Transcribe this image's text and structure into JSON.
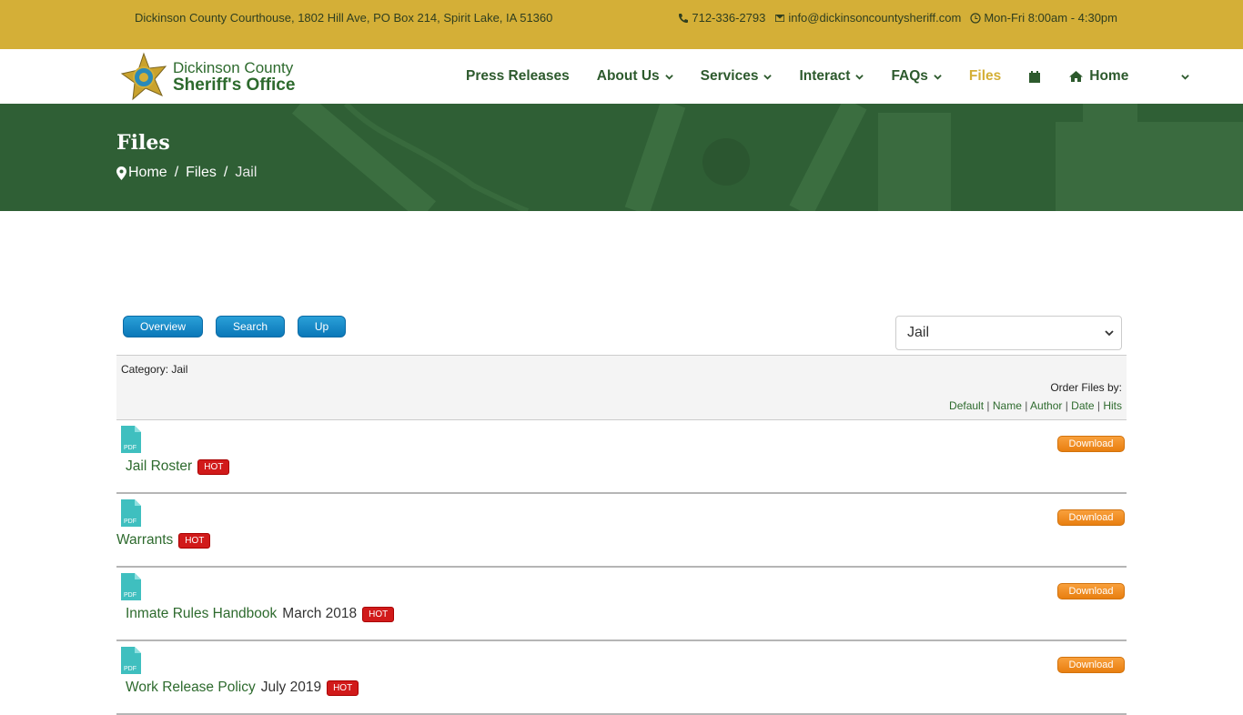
{
  "topbar": {
    "address": "Dickinson County Courthouse, 1802 Hill Ave, PO Box 214, Spirit Lake, IA 51360",
    "phone": "712-336-2793",
    "email": "info@dickinsoncountysheriff.com",
    "hours": "Mon-Fri 8:00am - 4:30pm"
  },
  "logo": {
    "line1": "Dickinson County",
    "line2": "Sheriff's Office"
  },
  "nav": {
    "items": [
      {
        "label": "Press Releases"
      },
      {
        "label": "About Us"
      },
      {
        "label": "Services"
      },
      {
        "label": "Interact"
      },
      {
        "label": "FAQs"
      },
      {
        "label": "Files"
      },
      {
        "label": "Home"
      }
    ]
  },
  "hero": {
    "title": "Files",
    "breadcrumbs": [
      "Home",
      "Files",
      "Jail"
    ]
  },
  "toolbar": {
    "overview": "Overview",
    "search": "Search",
    "up": "Up"
  },
  "category_select": {
    "value": "Jail"
  },
  "category": {
    "label": "Category: Jail",
    "order_label": "Order Files by:",
    "sort": [
      "Default",
      "Name",
      "Author",
      "Date",
      "Hits"
    ]
  },
  "files": [
    {
      "name": "Jail Roster",
      "extra": "",
      "badge": "HOT",
      "download": "Download"
    },
    {
      "name": "Warrants",
      "extra": "",
      "badge": "HOT",
      "download": "Download"
    },
    {
      "name": "Inmate Rules Handbook",
      "extra": "March 2018",
      "badge": "HOT",
      "download": "Download"
    },
    {
      "name": "Work Release Policy",
      "extra": "July 2019",
      "badge": "HOT",
      "download": "Download"
    }
  ],
  "icons": {
    "phone": "phone-icon",
    "email": "envelope-icon",
    "hours": "clock-icon",
    "calendar": "calendar-icon",
    "home": "home-icon",
    "pin": "map-pin-icon",
    "pdf": "pdf-file-icon"
  },
  "colors": {
    "gold": "#d4af37",
    "green": "#2f5f35",
    "link": "#2d6a2d",
    "hot": "#d11a1a",
    "download": "#f39227",
    "button": "#0a77b8"
  }
}
